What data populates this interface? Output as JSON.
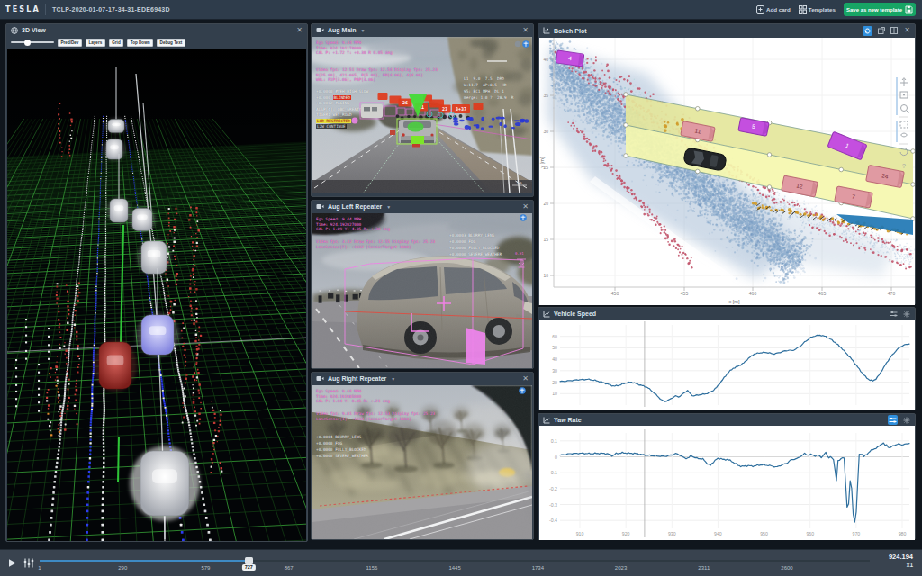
{
  "app": {
    "logo": "TESLA",
    "title": "TCLP-2020-01-07-17-34-31-EDE6943D",
    "toolbar": {
      "add_card": "Add card",
      "templates": "Templates",
      "save_template": "Save as new template"
    }
  },
  "view3d": {
    "title": "3D View",
    "buttons": [
      "Pred/Dev",
      "Layers",
      "Grid",
      "Top Down",
      "Debug Text"
    ],
    "slider_value": 0.38
  },
  "aug_main": {
    "title": "Aug Main",
    "telemetry": [
      "Ego Speed: 9.44 MPH",
      "Time: 924.191178000",
      "CAL P: +1.72 Y: +0.30 R 0.05 deg"
    ],
    "fps": [
      "Video fps: 12.51 Draw fps: 12.54 Display fps: 25.23",
      "N[25.00], 421-065, P[5.06], PP[4.06], 4[4.06]",
      "WHL: P1P[3.06], PAP[3.06]"
    ],
    "flags": [
      {
        "t": "+0.0000 #VEH_HIGH SLOW",
        "s": "plain"
      },
      {
        "t": "+0.000 BLINDED",
        "s": "red"
      },
      {
        "t": "+0.0002 #AGING",
        "s": "plain"
      },
      {
        "t": "ALSP[4]: OBC_GREATY",
        "s": "plain"
      },
      {
        "t": "TIGER1 WET_ROAD",
        "s": "plain"
      },
      {
        "t": "LOD RESTRICTED",
        "s": "yellow"
      },
      {
        "t": "L2W CONTINUE",
        "s": "dim"
      }
    ],
    "right_block": [
      "L1  9.0  7.5  DRD",
      "W:11.7  AP:8.5  HD",
      "95: EC1 MPH  DL 1",
      "merge: 1.0 ?  28.9  R"
    ],
    "detections": [
      "26",
      "41",
      "23",
      "3+37"
    ],
    "scale_label": "5m"
  },
  "aug_left": {
    "title": "Aug Left Repeater",
    "telemetry": [
      "Ego Speed: 9.44 MPH",
      "Time: 924.192027000",
      "CAL P: 1.89 Y: 4.35 R: +.30 deg"
    ],
    "fps": [
      "Video fps: 3.32 Draw fps: 12.55 Display fps: 25.23",
      "LaneSensor[7]: +1932 [SensorTarget 1000]"
    ],
    "right_block": [
      "+0.0003 BLURRY_LENS",
      "+0.0000 FOG",
      "+0.0000 FULLY_BLOCKED",
      "+0.0000 SEVERE_WEATHER"
    ],
    "marker": "0.91"
  },
  "aug_right": {
    "title": "Aug Right Repeater",
    "telemetry": [
      "Ego Speed: 9.44 MPH",
      "Time: 924.191985000",
      "CAL P: 1.04 Y: 0.85 R: +.21 deg"
    ],
    "fps": [
      "Video fps: 9.81 Draw fps: 12.53 Display fps: 25.23",
      "LaneSensor[1]: +1932 [SensorTarget 1000]"
    ],
    "right_block": [
      "+0.0004 BLURRY_LENS",
      "+0.0000 FOG",
      "+0.0000 FULLY_BLOCKED",
      "+0.0000 SEVERE_WEATHER"
    ]
  },
  "bokeh_panel": {
    "title": "Bokeh Plot"
  },
  "speed_panel": {
    "title": "Vehicle Speed"
  },
  "yaw_panel": {
    "title": "Yaw Rate"
  },
  "timeline": {
    "labels": [
      "1",
      "290",
      "579",
      "867",
      "1156",
      "1445",
      "1734",
      "2023",
      "2311",
      "2600"
    ],
    "current": "727",
    "fraction": 0.252,
    "time": "924.194",
    "rate": "x1"
  },
  "chart_data": [
    {
      "id": "bokeh",
      "type": "scatter",
      "title": "Bokeh Plot",
      "xlabel": "x [m]",
      "ylabel": "y [m]",
      "x_ticks": [
        450,
        455,
        460,
        465,
        470
      ],
      "y_ticks": [
        40,
        35,
        30,
        25,
        20,
        15,
        10
      ],
      "ego": {
        "x": 184,
        "y": 135,
        "angle": 11
      },
      "vehicles_pink": [
        {
          "label": "11",
          "x": 176,
          "y": 104,
          "w": 36,
          "h": 16,
          "angle": 11
        },
        {
          "label": "12",
          "x": 289,
          "y": 165,
          "w": 38,
          "h": 17,
          "angle": 11
        },
        {
          "label": "7",
          "x": 349,
          "y": 177,
          "w": 40,
          "h": 17,
          "angle": 11
        },
        {
          "label": "24",
          "x": 384,
          "y": 154,
          "w": 40,
          "h": 18,
          "angle": 11
        }
      ],
      "vehicles_purple": [
        {
          "label": "4",
          "x": 34,
          "y": 23,
          "w": 30,
          "h": 14,
          "angle": 8
        },
        {
          "label": "5",
          "x": 238,
          "y": 99,
          "w": 32,
          "h": 15,
          "angle": 11
        },
        {
          "label": "1",
          "x": 342,
          "y": 120,
          "w": 40,
          "h": 18,
          "angle": 22
        }
      ],
      "band": {
        "x0": 96,
        "x1": 415,
        "top0": 63,
        "top1": 126,
        "mid0": 97,
        "mid1": 163,
        "bot0": 131,
        "bot1": 201
      }
    },
    {
      "id": "speed",
      "type": "line",
      "title": "Vehicle Speed",
      "ylabel": "",
      "y_ticks": [
        60,
        50,
        40,
        30,
        20,
        10
      ],
      "y_min": 0,
      "y_max": 70,
      "cursor_frac": 0.242,
      "points": [
        [
          0,
          20.5
        ],
        [
          0.02,
          21
        ],
        [
          0.05,
          22
        ],
        [
          0.08,
          22.5
        ],
        [
          0.1,
          21.5
        ],
        [
          0.12,
          20
        ],
        [
          0.14,
          18
        ],
        [
          0.155,
          16.5
        ],
        [
          0.17,
          17.5
        ],
        [
          0.19,
          19.5
        ],
        [
          0.205,
          20
        ],
        [
          0.22,
          18.5
        ],
        [
          0.235,
          17
        ],
        [
          0.25,
          15.5
        ],
        [
          0.26,
          13
        ],
        [
          0.275,
          9
        ],
        [
          0.29,
          4.5
        ],
        [
          0.3,
          3
        ],
        [
          0.315,
          5
        ],
        [
          0.33,
          8
        ],
        [
          0.34,
          7
        ],
        [
          0.355,
          10.5
        ],
        [
          0.365,
          13
        ],
        [
          0.372,
          10
        ],
        [
          0.38,
          8
        ],
        [
          0.39,
          8.5
        ],
        [
          0.4,
          9
        ],
        [
          0.42,
          10
        ],
        [
          0.435,
          12
        ],
        [
          0.45,
          16
        ],
        [
          0.465,
          22
        ],
        [
          0.48,
          28
        ],
        [
          0.495,
          32
        ],
        [
          0.51,
          34
        ],
        [
          0.525,
          36.5
        ],
        [
          0.54,
          41
        ],
        [
          0.555,
          44.5
        ],
        [
          0.57,
          45.5
        ],
        [
          0.585,
          46
        ],
        [
          0.6,
          45.5
        ],
        [
          0.61,
          44.5
        ],
        [
          0.625,
          45.5
        ],
        [
          0.64,
          47
        ],
        [
          0.655,
          48
        ],
        [
          0.665,
          47.5
        ],
        [
          0.675,
          49
        ],
        [
          0.69,
          52
        ],
        [
          0.7,
          55
        ],
        [
          0.715,
          58.5
        ],
        [
          0.73,
          60.5
        ],
        [
          0.745,
          61
        ],
        [
          0.76,
          60
        ],
        [
          0.775,
          57.5
        ],
        [
          0.79,
          54
        ],
        [
          0.805,
          50
        ],
        [
          0.82,
          45
        ],
        [
          0.835,
          40
        ],
        [
          0.85,
          34
        ],
        [
          0.865,
          28
        ],
        [
          0.875,
          24.5
        ],
        [
          0.885,
          22
        ],
        [
          0.895,
          21
        ],
        [
          0.905,
          23
        ],
        [
          0.915,
          27
        ],
        [
          0.925,
          32
        ],
        [
          0.935,
          37
        ],
        [
          0.945,
          41.5
        ],
        [
          0.955,
          45
        ],
        [
          0.965,
          48.5
        ],
        [
          0.975,
          51
        ],
        [
          0.985,
          52.5
        ],
        [
          1,
          53.5
        ]
      ]
    },
    {
      "id": "yaw",
      "type": "line",
      "title": "Yaw Rate",
      "ylabel": "",
      "y_ticks": [
        0.1,
        0,
        -0.1,
        -0.2,
        -0.3,
        -0.4
      ],
      "x_ticks": [
        910,
        920,
        930,
        940,
        950,
        960,
        970,
        980
      ],
      "y_min": -0.45,
      "y_max": 0.15,
      "cursor_frac": 0.242,
      "points": [
        [
          0,
          0.01
        ],
        [
          0.03,
          0.02
        ],
        [
          0.06,
          0.022
        ],
        [
          0.09,
          0.02
        ],
        [
          0.12,
          0.022
        ],
        [
          0.14,
          0.018
        ],
        [
          0.15,
          0.005
        ],
        [
          0.16,
          0.02
        ],
        [
          0.18,
          0.025
        ],
        [
          0.2,
          0.022
        ],
        [
          0.22,
          0.02
        ],
        [
          0.24,
          0.012
        ],
        [
          0.26,
          0.008
        ],
        [
          0.28,
          0.005
        ],
        [
          0.3,
          0.003
        ],
        [
          0.32,
          0.012
        ],
        [
          0.33,
          0.02
        ],
        [
          0.34,
          0.015
        ],
        [
          0.35,
          0
        ],
        [
          0.36,
          -0.01
        ],
        [
          0.37,
          -0.005
        ],
        [
          0.375,
          0.01
        ],
        [
          0.385,
          -0.005
        ],
        [
          0.395,
          -0.01
        ],
        [
          0.41,
          -0.015
        ],
        [
          0.42,
          -0.04
        ],
        [
          0.43,
          -0.055
        ],
        [
          0.44,
          -0.03
        ],
        [
          0.45,
          -0.012
        ],
        [
          0.46,
          -0.01
        ],
        [
          0.47,
          -0.02
        ],
        [
          0.48,
          -0.015
        ],
        [
          0.5,
          -0.04
        ],
        [
          0.51,
          -0.055
        ],
        [
          0.52,
          -0.06
        ],
        [
          0.54,
          -0.055
        ],
        [
          0.55,
          -0.06
        ],
        [
          0.56,
          -0.055
        ],
        [
          0.58,
          -0.05
        ],
        [
          0.6,
          -0.055
        ],
        [
          0.61,
          -0.06
        ],
        [
          0.62,
          -0.065
        ],
        [
          0.63,
          -0.055
        ],
        [
          0.65,
          -0.04
        ],
        [
          0.66,
          -0.02
        ],
        [
          0.67,
          -0.015
        ],
        [
          0.68,
          -0.01
        ],
        [
          0.69,
          0.005
        ],
        [
          0.7,
          0.02
        ],
        [
          0.71,
          0.01
        ],
        [
          0.72,
          0.015
        ],
        [
          0.73,
          0.005
        ],
        [
          0.74,
          0.01
        ],
        [
          0.75,
          -0.005
        ],
        [
          0.76,
          0.03
        ],
        [
          0.765,
          0.01
        ],
        [
          0.77,
          -0.01
        ],
        [
          0.775,
          0.005
        ],
        [
          0.78,
          -0.02
        ],
        [
          0.785,
          -0.01
        ],
        [
          0.79,
          -0.19
        ],
        [
          0.795,
          -0.03
        ],
        [
          0.8,
          -0.02
        ],
        [
          0.805,
          -0.01
        ],
        [
          0.81,
          0
        ],
        [
          0.815,
          -0.02
        ],
        [
          0.82,
          -0.31
        ],
        [
          0.825,
          -0.33
        ],
        [
          0.83,
          -0.15
        ],
        [
          0.835,
          -0.2
        ],
        [
          0.84,
          -0.4
        ],
        [
          0.845,
          -0.41
        ],
        [
          0.85,
          -0.3
        ],
        [
          0.855,
          0.01
        ],
        [
          0.86,
          0.02
        ],
        [
          0.865,
          0.015
        ],
        [
          0.87,
          0
        ],
        [
          0.875,
          0.01
        ],
        [
          0.88,
          0.02
        ],
        [
          0.89,
          0.04
        ],
        [
          0.9,
          0.05
        ],
        [
          0.91,
          0.06
        ],
        [
          0.92,
          0.08
        ],
        [
          0.925,
          0.09
        ],
        [
          0.93,
          0.07
        ],
        [
          0.935,
          0.075
        ],
        [
          0.94,
          0.06
        ],
        [
          0.945,
          0.055
        ],
        [
          0.95,
          0.065
        ],
        [
          0.96,
          0.075
        ],
        [
          0.97,
          0.08
        ],
        [
          0.98,
          0.075
        ],
        [
          0.99,
          0.08
        ],
        [
          1,
          0.085
        ]
      ]
    }
  ]
}
